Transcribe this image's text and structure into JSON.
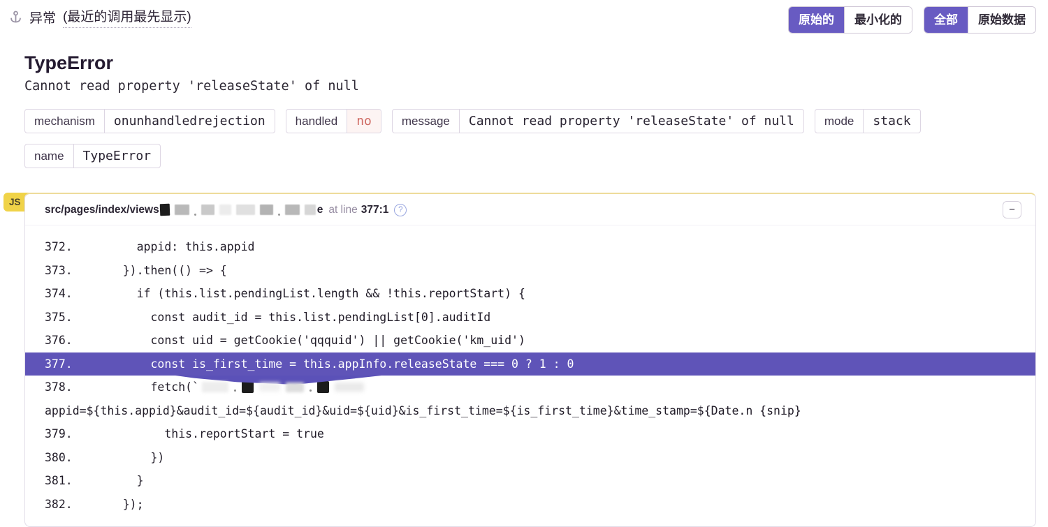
{
  "header": {
    "title": "异常",
    "subtitle": "(最近的调用最先显示)"
  },
  "toolbar": {
    "groups": [
      {
        "buttons": [
          {
            "label": "原始的",
            "active": true
          },
          {
            "label": "最小化的",
            "active": false
          }
        ]
      },
      {
        "buttons": [
          {
            "label": "全部",
            "active": true
          },
          {
            "label": "原始数据",
            "active": false
          }
        ]
      }
    ]
  },
  "error": {
    "name": "TypeError",
    "message": "Cannot read property 'releaseState' of null"
  },
  "tags": [
    {
      "key": "mechanism",
      "value": "onunhandledrejection",
      "alert": false
    },
    {
      "key": "handled",
      "value": "no",
      "alert": true
    },
    {
      "key": "message",
      "value": "Cannot read property 'releaseState' of null",
      "alert": false
    },
    {
      "key": "mode",
      "value": "stack",
      "alert": false
    },
    {
      "key": "name",
      "value": "TypeError",
      "alert": false
    }
  ],
  "frame": {
    "badge": "JS",
    "path_prefix": "src/pages/index/views",
    "path_suffix": "e",
    "at_line_label": "at line",
    "line_ref": "377:1",
    "help_glyph": "?",
    "collapse_glyph": "−",
    "accent_colors": {
      "highlight": "#5f54b8",
      "button_active": "#685bc2",
      "badge_yellow": "#f0d348"
    },
    "code": [
      {
        "no": "372.",
        "text": "      appid: this.appid"
      },
      {
        "no": "373.",
        "text": "    }).then(() => {"
      },
      {
        "no": "374.",
        "text": "      if (this.list.pendingList.length && !this.reportStart) {"
      },
      {
        "no": "375.",
        "text": "        const audit_id = this.list.pendingList[0].auditId"
      },
      {
        "no": "376.",
        "text": "        const uid = getCookie('qqquid') || getCookie('km_uid')"
      },
      {
        "no": "377.",
        "text": "        const is_first_time = this.appInfo.releaseState === 0 ? 1 : 0",
        "highlight": true
      },
      {
        "no": "378.",
        "text": "        fetch(`",
        "redacted": true
      },
      {
        "no": "",
        "text": "appid=${this.appid}&audit_id=${audit_id}&uid=${uid}&is_first_time=${is_first_time}&time_stamp=${Date.n {snip}",
        "wrap": true
      },
      {
        "no": "379.",
        "text": "          this.reportStart = true"
      },
      {
        "no": "380.",
        "text": "        })"
      },
      {
        "no": "381.",
        "text": "      }"
      },
      {
        "no": "382.",
        "text": "    });"
      }
    ]
  }
}
